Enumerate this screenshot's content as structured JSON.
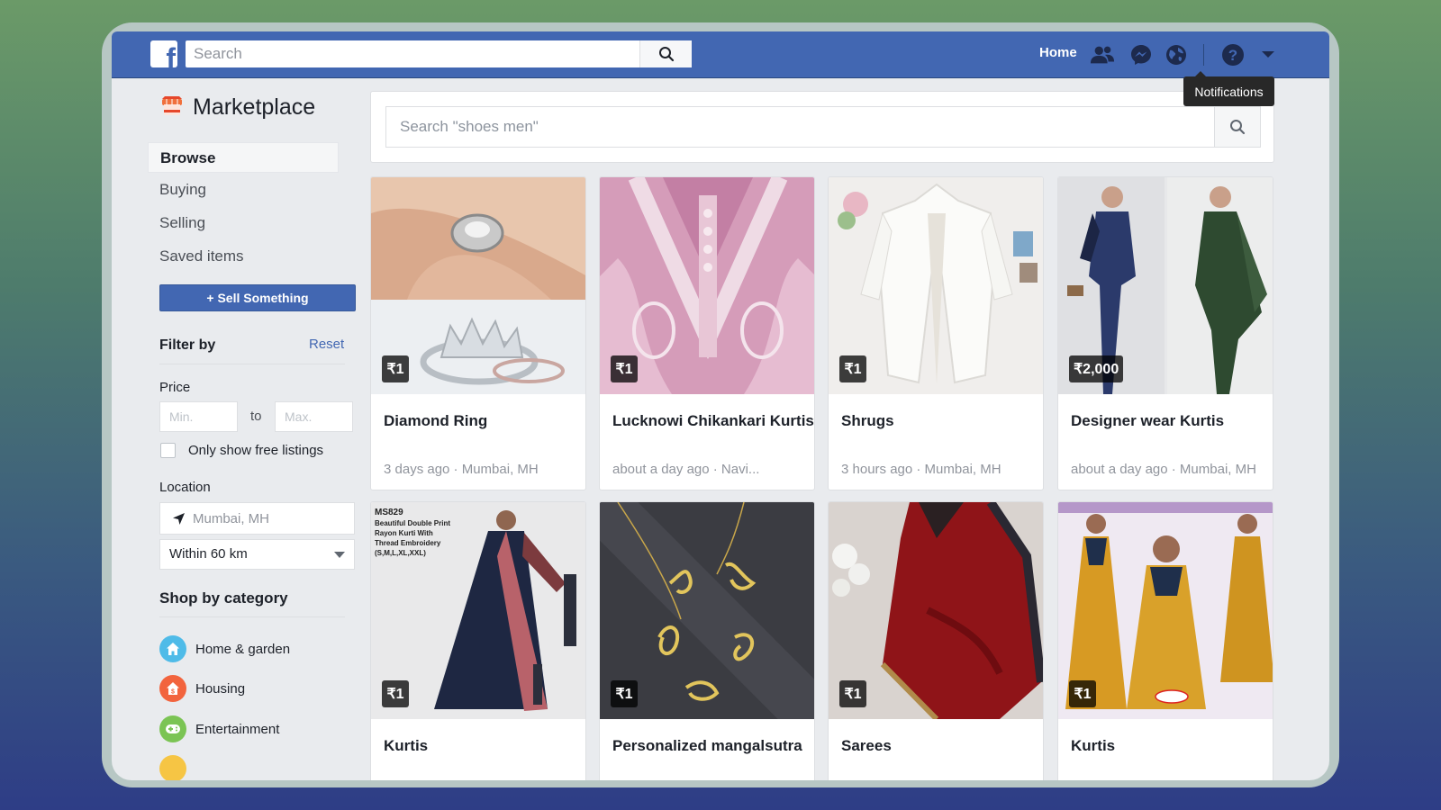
{
  "topbar": {
    "logo": "f",
    "search_placeholder": "Search",
    "home_label": "Home",
    "tooltip": "Notifications",
    "icons": [
      "friends-icon",
      "messenger-icon",
      "notifications-globe-icon",
      "help-icon",
      "dropdown-caret-icon"
    ]
  },
  "sidebar": {
    "title": "Marketplace",
    "nav": [
      {
        "label": "Browse",
        "active": true
      },
      {
        "label": "Buying"
      },
      {
        "label": "Selling"
      },
      {
        "label": "Saved items"
      }
    ],
    "sell_button": "+ Sell Something",
    "filter_title": "Filter by",
    "reset": "Reset",
    "price_label": "Price",
    "min_placeholder": "Min.",
    "to": "to",
    "max_placeholder": "Max.",
    "free_listings": "Only show free listings",
    "location_label": "Location",
    "location_placeholder": "Mumbai, MH",
    "radius": "Within 60 km",
    "category_title": "Shop by category",
    "categories": [
      {
        "label": "Home & garden",
        "color": "#4fbbe8",
        "icon": "home-icon"
      },
      {
        "label": "Housing",
        "color": "#f2643e",
        "icon": "housing-icon"
      },
      {
        "label": "Entertainment",
        "color": "#7bc454",
        "icon": "gamepad-icon"
      }
    ]
  },
  "main": {
    "search_placeholder": "Search \"shoes men\"",
    "listings": [
      {
        "price": "₹1",
        "title": "Diamond Ring",
        "meta": "3 days ago · Mumbai, MH"
      },
      {
        "price": "₹1",
        "title": "Lucknowi Chikankari Kurtis",
        "meta": "about a day ago · Navi..."
      },
      {
        "price": "₹1",
        "title": "Shrugs",
        "meta": "3 hours ago · Mumbai, MH"
      },
      {
        "price": "₹2,000",
        "title": "Designer wear Kurtis",
        "meta": "about a day ago · Mumbai, MH"
      },
      {
        "price": "₹1",
        "title": "Kurtis",
        "meta": ""
      },
      {
        "price": "₹1",
        "title": "Personalized mangalsutra",
        "meta": ""
      },
      {
        "price": "₹1",
        "title": "Sarees",
        "meta": ""
      },
      {
        "price": "₹1",
        "title": "Kurtis",
        "meta": ""
      }
    ]
  },
  "colors": {
    "brand": "#4267b2",
    "page_bg": "#e9ebee"
  }
}
